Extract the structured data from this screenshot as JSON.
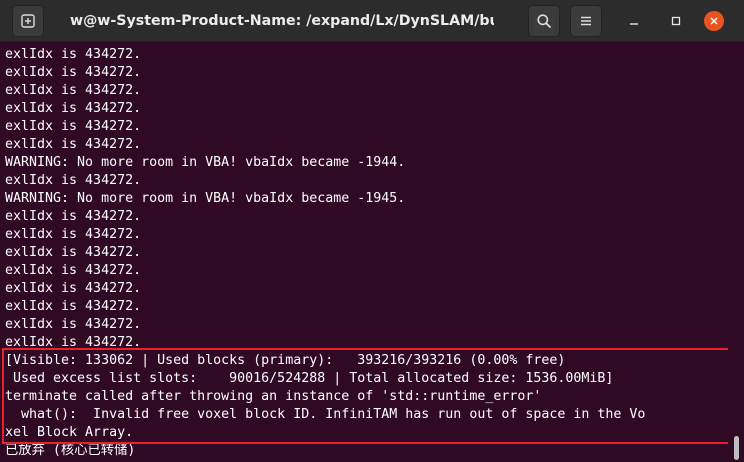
{
  "window": {
    "title": "w@w-System-Product-Name: /expand/Lx/DynSLAM/build"
  },
  "titlebar_icons": {
    "new_tab": "new-tab-icon",
    "search": "search-icon",
    "menu": "hamburger-menu-icon",
    "minimize": "minimize-icon",
    "maximize": "maximize-icon",
    "close": "close-icon"
  },
  "colors": {
    "terminal_background": "#300a24",
    "titlebar_background": "#2c2c2c",
    "close_button": "#e95420",
    "highlight_border": "#e8222a"
  },
  "terminal": {
    "lines": [
      "exlIdx is 434272.",
      "exlIdx is 434272.",
      "exlIdx is 434272.",
      "exlIdx is 434272.",
      "exlIdx is 434272.",
      "exlIdx is 434272.",
      "WARNING: No more room in VBA! vbaIdx became -1944.",
      "exlIdx is 434272.",
      "WARNING: No more room in VBA! vbaIdx became -1945.",
      "exlIdx is 434272.",
      "exlIdx is 434272.",
      "exlIdx is 434272.",
      "exlIdx is 434272.",
      "exlIdx is 434272.",
      "exlIdx is 434272.",
      "exlIdx is 434272.",
      "exlIdx is 434272.",
      "[Visible: 133062 | Used blocks (primary):   393216/393216 (0.00% free)",
      " Used excess list slots:    90016/524288 | Total allocated size: 1536.00MiB]",
      "terminate called after throwing an instance of 'std::runtime_error'",
      "  what():  Invalid free voxel block ID. InfiniTAM has run out of space in the Vo",
      "xel Block Array.",
      "已放弃 (核心已转储)"
    ]
  }
}
